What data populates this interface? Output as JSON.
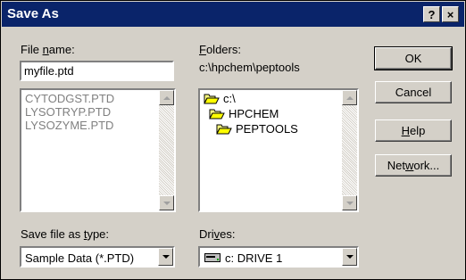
{
  "window": {
    "title": "Save As",
    "help_btn": "?",
    "close_btn": "×"
  },
  "file_name": {
    "label_pre": "File ",
    "label_ul": "n",
    "label_post": "ame:",
    "value": "myfile.ptd"
  },
  "file_list": {
    "items": [
      "CYTODGST.PTD",
      "LYSOTRYP.PTD",
      "LYSOZYME.PTD"
    ]
  },
  "folders": {
    "label_ul": "F",
    "label_post": "olders:",
    "current_path": "c:\\hpchem\\peptools",
    "items": [
      {
        "label": "c:\\"
      },
      {
        "label": "HPCHEM"
      },
      {
        "label": "PEPTOOLS"
      }
    ]
  },
  "save_type": {
    "label_pre": "Save file as ",
    "label_ul": "t",
    "label_post": "ype:",
    "value": "Sample Data (*.PTD)"
  },
  "drives": {
    "label_pre": "Dri",
    "label_ul": "v",
    "label_post": "es:",
    "value": "c: DRIVE 1"
  },
  "buttons": {
    "ok": "OK",
    "cancel": "Cancel",
    "help_ul": "H",
    "help_post": "elp",
    "network_pre": "Net",
    "network_ul": "w",
    "network_post": "ork..."
  },
  "colors": {
    "title_bar": "#0a246a",
    "dialog_bg": "#d4d0c8"
  }
}
